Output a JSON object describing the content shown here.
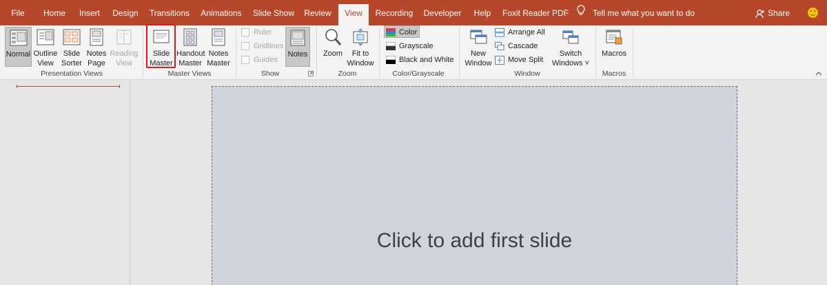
{
  "tabs": [
    {
      "label": "File"
    },
    {
      "label": "Home"
    },
    {
      "label": "Insert"
    },
    {
      "label": "Design"
    },
    {
      "label": "Transitions"
    },
    {
      "label": "Animations"
    },
    {
      "label": "Slide Show"
    },
    {
      "label": "Review"
    },
    {
      "label": "View",
      "active": true
    },
    {
      "label": "Recording"
    },
    {
      "label": "Developer"
    },
    {
      "label": "Help"
    },
    {
      "label": "Foxit Reader PDF"
    }
  ],
  "tell_me": "Tell me what you want to do",
  "share": "Share",
  "colors": {
    "accent": "#b7472a",
    "ribbon": "#f3f3f3",
    "highlight": "#e8141b",
    "slide_bg": "#d0d4dd"
  },
  "ribbon": {
    "presentation_views": {
      "label": "Presentation Views",
      "buttons": [
        {
          "label": "Normal",
          "state": "pressed"
        },
        {
          "label": "Outline\nView"
        },
        {
          "label": "Slide\nSorter"
        },
        {
          "label": "Notes\nPage"
        },
        {
          "label": "Reading\nView",
          "state": "disabled"
        }
      ]
    },
    "master_views": {
      "label": "Master Views",
      "buttons": [
        {
          "label": "Slide\nMaster",
          "highlighted": true
        },
        {
          "label": "Handout\nMaster"
        },
        {
          "label": "Notes\nMaster"
        }
      ]
    },
    "show": {
      "label": "Show",
      "checkboxes": [
        {
          "label": "Ruler",
          "checked": false,
          "disabled": true
        },
        {
          "label": "Gridlines",
          "checked": false,
          "disabled": true
        },
        {
          "label": "Guides",
          "checked": false,
          "disabled": true
        }
      ],
      "notes_button": {
        "label": "Notes",
        "state": "pressed"
      }
    },
    "zoom": {
      "label": "Zoom",
      "buttons": [
        {
          "label": "Zoom"
        },
        {
          "label": "Fit to\nWindow"
        }
      ]
    },
    "color_grayscale": {
      "label": "Color/Grayscale",
      "options": [
        {
          "label": "Color",
          "selected": true
        },
        {
          "label": "Grayscale"
        },
        {
          "label": "Black and White"
        }
      ]
    },
    "window": {
      "label": "Window",
      "new_window": {
        "label": "New\nWindow"
      },
      "small": [
        {
          "label": "Arrange All"
        },
        {
          "label": "Cascade"
        },
        {
          "label": "Move Split"
        }
      ],
      "switch_windows": {
        "label": "Switch\nWindows ˅"
      }
    },
    "macros": {
      "label": "Macros",
      "button": {
        "label": "Macros"
      }
    }
  },
  "slide_placeholder": "Click to add first slide"
}
